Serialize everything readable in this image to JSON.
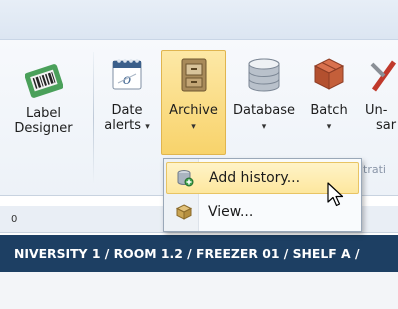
{
  "ribbon": {
    "buttons": [
      {
        "id": "label-designer",
        "label_line1": "Label",
        "label_line2": "Designer",
        "icon": "barcode-label-icon"
      },
      {
        "id": "date-alerts",
        "label_line1": "Date",
        "label_line2": "alerts",
        "arrow": "▾",
        "icon": "calendar-icon"
      },
      {
        "id": "archive",
        "label_line1": "Archive",
        "arrow": "▾",
        "icon": "archive-box-icon"
      },
      {
        "id": "database",
        "label_line1": "Database",
        "arrow": "▾",
        "icon": "database-icon"
      },
      {
        "id": "batch",
        "label_line1": "Batch",
        "arrow": "▾",
        "icon": "batch-boxes-icon"
      },
      {
        "id": "unsample",
        "label_line1": "Un-",
        "label_line2": "sar",
        "icon": "tools-icon"
      }
    ],
    "group_label_partial": "trati"
  },
  "tabstrip": {
    "mark": "0"
  },
  "path": "NIVERSITY 1 / ROOM 1.2 / FREEZER 01 / SHELF A /",
  "menu": {
    "items": [
      {
        "label": "Add history...",
        "icon": "add-history-icon",
        "highlighted": true
      },
      {
        "label": "View...",
        "icon": "view-icon",
        "highlighted": false
      }
    ]
  },
  "colors": {
    "accent_hover": "#fde79e",
    "path_bar": "#1d3f63",
    "ribbon_bg": "#edf2f8"
  }
}
